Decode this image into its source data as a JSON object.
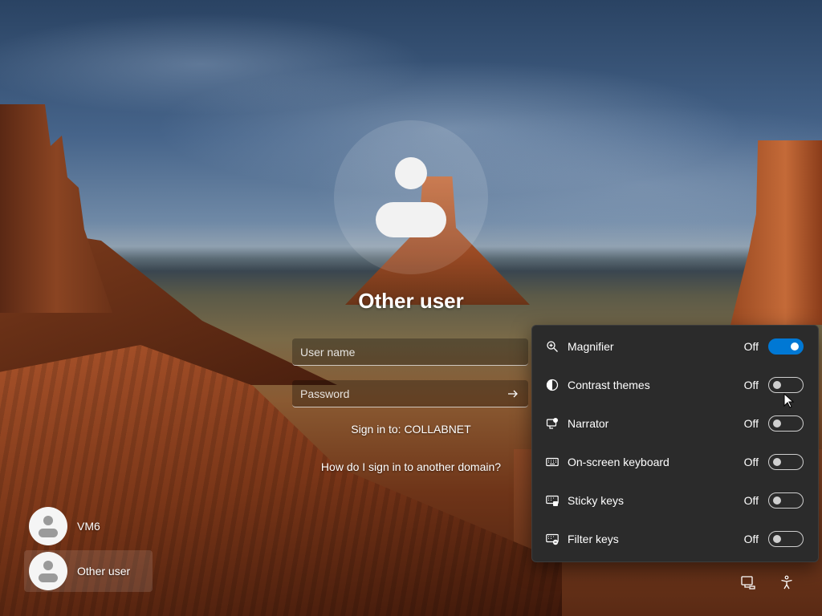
{
  "login": {
    "title": "Other user",
    "username_placeholder": "User name",
    "password_placeholder": "Password",
    "sign_in_to": "Sign in to: COLLABNET",
    "domain_help": "How do I sign in to another domain?"
  },
  "users": [
    {
      "name": "VM6",
      "selected": false
    },
    {
      "name": "Other user",
      "selected": true
    }
  ],
  "accessibility": {
    "items": [
      {
        "icon": "magnifier-icon",
        "label": "Magnifier",
        "state": "Off",
        "on": true
      },
      {
        "icon": "contrast-icon",
        "label": "Contrast themes",
        "state": "Off",
        "on": false
      },
      {
        "icon": "narrator-icon",
        "label": "Narrator",
        "state": "Off",
        "on": false
      },
      {
        "icon": "keyboard-icon",
        "label": "On-screen keyboard",
        "state": "Off",
        "on": false
      },
      {
        "icon": "sticky-keys-icon",
        "label": "Sticky keys",
        "state": "Off",
        "on": false
      },
      {
        "icon": "filter-keys-icon",
        "label": "Filter keys",
        "state": "Off",
        "on": false
      }
    ]
  },
  "tray": {
    "icons": [
      "network-icon",
      "accessibility-icon"
    ]
  },
  "colors": {
    "accent": "#0078d4",
    "flyout_bg": "#2b2b2b"
  }
}
